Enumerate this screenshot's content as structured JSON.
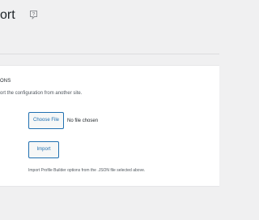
{
  "header": {
    "title": "ort",
    "help_icon": "help-page-icon"
  },
  "section": {
    "heading": "ONS",
    "description": "ort the configuration from another site."
  },
  "file_input": {
    "button_label": "Choose File",
    "status": "No file chosen"
  },
  "import": {
    "button_label": "Import",
    "note": "Import Profile Builder options from the .JSON file selected above."
  },
  "colors": {
    "background": "#f0f0f1",
    "panel": "#ffffff",
    "accent": "#2271b1"
  }
}
